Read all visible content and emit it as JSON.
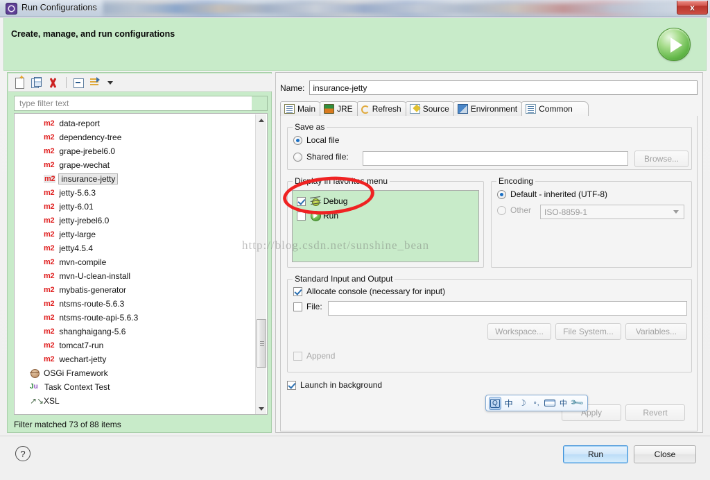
{
  "window": {
    "title": "Run Configurations",
    "close_label": "x"
  },
  "header": {
    "title": "Create, manage, and run configurations",
    "play_icon": "run-play-icon"
  },
  "left_panel": {
    "toolbar": [
      {
        "name": "new-configuration-icon",
        "label": "New launch configuration"
      },
      {
        "name": "duplicate-configuration-icon",
        "label": "Duplicate"
      },
      {
        "name": "delete-configuration-icon",
        "label": "Delete"
      },
      {
        "name": "collapse-all-icon",
        "label": "Collapse All"
      },
      {
        "name": "filter-launch-configurations-icon",
        "label": "Filter"
      },
      {
        "name": "chevron-down-icon",
        "label": "Menu"
      }
    ],
    "filter": {
      "placeholder": "type filter text",
      "value": ""
    },
    "tree_items": [
      {
        "icon": "m2",
        "label": "data-report",
        "selected": false
      },
      {
        "icon": "m2",
        "label": "dependency-tree",
        "selected": false
      },
      {
        "icon": "m2",
        "label": "grape-jrebel6.0",
        "selected": false
      },
      {
        "icon": "m2",
        "label": "grape-wechat",
        "selected": false
      },
      {
        "icon": "m2",
        "label": "insurance-jetty",
        "selected": true
      },
      {
        "icon": "m2",
        "label": "jetty-5.6.3",
        "selected": false
      },
      {
        "icon": "m2",
        "label": "jetty-6.01",
        "selected": false
      },
      {
        "icon": "m2",
        "label": "jetty-jrebel6.0",
        "selected": false
      },
      {
        "icon": "m2",
        "label": "jetty-large",
        "selected": false
      },
      {
        "icon": "m2",
        "label": "jetty4.5.4",
        "selected": false
      },
      {
        "icon": "m2",
        "label": "mvn-compile",
        "selected": false
      },
      {
        "icon": "m2",
        "label": "mvn-U-clean-install",
        "selected": false
      },
      {
        "icon": "m2",
        "label": "mybatis-generator",
        "selected": false
      },
      {
        "icon": "m2",
        "label": "ntsms-route-5.6.3",
        "selected": false
      },
      {
        "icon": "m2",
        "label": "ntsms-route-api-5.6.3",
        "selected": false
      },
      {
        "icon": "m2",
        "label": "shanghaigang-5.6",
        "selected": false
      },
      {
        "icon": "m2",
        "label": "tomcat7-run",
        "selected": false
      },
      {
        "icon": "m2",
        "label": "wechart-jetty",
        "selected": false
      },
      {
        "icon": "osgi",
        "label": "OSGi Framework",
        "selected": false
      },
      {
        "icon": "junit",
        "label": "Task Context Test",
        "selected": false
      },
      {
        "icon": "xsl",
        "label": "XSL",
        "selected": false
      }
    ],
    "status": "Filter matched 73 of 88 items"
  },
  "right_panel": {
    "name_label": "Name:",
    "name_value": "insurance-jetty",
    "tabs": [
      {
        "label": "Main",
        "icon": "main-tab-icon",
        "active": false
      },
      {
        "label": "JRE",
        "icon": "jre-tab-icon",
        "active": false
      },
      {
        "label": "Refresh",
        "icon": "refresh-tab-icon",
        "active": false
      },
      {
        "label": "Source",
        "icon": "source-tab-icon",
        "active": false
      },
      {
        "label": "Environment",
        "icon": "environment-tab-icon",
        "active": false
      },
      {
        "label": "Common",
        "icon": "common-tab-icon",
        "active": true
      }
    ],
    "save_as": {
      "group_title": "Save as",
      "local_file_label": "Local file",
      "local_file_selected": true,
      "shared_file_label": "Shared file:",
      "shared_file_selected": false,
      "shared_file_value": "",
      "browse_label": "Browse..."
    },
    "favorites": {
      "group_title": "Display in favorites menu",
      "items": [
        {
          "label": "Debug",
          "icon": "debug-bug-icon",
          "checked": true
        },
        {
          "label": "Run",
          "icon": "run-play-icon",
          "checked": false
        }
      ]
    },
    "encoding": {
      "group_title": "Encoding",
      "default_label": "Default - inherited (UTF-8)",
      "default_selected": true,
      "other_label": "Other",
      "other_selected": false,
      "other_value": "ISO-8859-1"
    },
    "standard_io": {
      "group_title": "Standard Input and Output",
      "allocate_console_label": "Allocate console (necessary for input)",
      "allocate_console_checked": true,
      "file_label": "File:",
      "file_checked": false,
      "file_value": "",
      "workspace_label": "Workspace...",
      "file_system_label": "File System...",
      "variables_label": "Variables...",
      "append_label": "Append",
      "append_checked": false
    },
    "launch_in_background": {
      "label": "Launch in background",
      "checked": true
    },
    "apply_label": "Apply",
    "revert_label": "Revert"
  },
  "ime_toolbar": {
    "buttons": [
      {
        "name": "ime-logo-icon",
        "glyph": "Q"
      },
      {
        "name": "ime-chinese-mode-icon",
        "glyph": "中"
      },
      {
        "name": "ime-moon-icon",
        "glyph": "☽"
      },
      {
        "name": "ime-punctuation-icon",
        "glyph": "∘,"
      },
      {
        "name": "ime-soft-keyboard-icon",
        "glyph": ""
      },
      {
        "name": "ime-traditional-toggle-icon",
        "glyph": "中"
      },
      {
        "name": "ime-settings-wrench-icon",
        "glyph": "🔧"
      }
    ]
  },
  "footer": {
    "help_label": "?",
    "run_label": "Run",
    "close_label": "Close"
  },
  "watermark": {
    "text": "http://blog.csdn.net/sunshine_bean"
  },
  "annotation": {
    "shape": "red-ellipse-highlight",
    "color": "#ef2222"
  }
}
